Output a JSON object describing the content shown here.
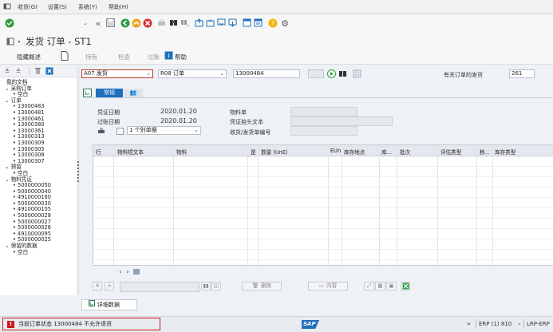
{
  "menubar": {
    "items": [
      "收货(G)",
      "设置(S)",
      "系统(Y)",
      "帮助(H)"
    ]
  },
  "title": {
    "text": "发货 订单 - ST1"
  },
  "appbar": {
    "hide_overview": "隐藏概述",
    "hold": "持有",
    "check": "检查",
    "post": "过账",
    "help": "帮助"
  },
  "header": {
    "action": "A07 发货",
    "ref_doc": "R08 订单",
    "order_number": "13000484",
    "right_label": "有关订单的发货",
    "movement_type": "261"
  },
  "tabs": {
    "general": "常规"
  },
  "general_fields": {
    "doc_date_label": "凭证日期",
    "doc_date": "2020.01.20",
    "post_date_label": "过账日期",
    "post_date": "2020.01.20",
    "slip_option": "1 个别单据",
    "material_slip_label": "物料单",
    "header_text_label": "凭证抬头文本",
    "goods_receipt_label": "收货/发货单编号"
  },
  "navigation": {
    "root": "我的文档",
    "groups": [
      {
        "label": "采购订单",
        "items": [
          "空白"
        ]
      },
      {
        "label": "订单",
        "items": [
          "13000483",
          "13000481",
          "13000461",
          "13000380",
          "13000361",
          "13000313",
          "13000309",
          "13000305",
          "13000308",
          "13000307"
        ]
      },
      {
        "label": "预留",
        "items": [
          "空白"
        ]
      },
      {
        "label": "物料凭证",
        "items": [
          "5000000050",
          "5000000040",
          "4910000160",
          "5000000030",
          "4910000105",
          "5000000028",
          "5000000027",
          "5000000026",
          "4910000095",
          "5000000025"
        ]
      },
      {
        "label": "保留的数据",
        "items": [
          "空白"
        ]
      }
    ]
  },
  "grid": {
    "columns": [
      "行",
      "物料短文本",
      "物料",
      "是",
      "数量 (UnE)",
      "EUn",
      "库存地点",
      "库...",
      "批次",
      "评估类型",
      "移...",
      "库存类型"
    ],
    "rows": []
  },
  "grid_toolbar": {
    "delete": "删除",
    "content": "内容"
  },
  "details": {
    "label": "详细数据"
  },
  "status": {
    "message": "当前订单状态 13000484 不允许退货",
    "system": "ERP (1) 810",
    "server": "LRP-ERP",
    "brand": "SAP"
  },
  "colors": {
    "accent": "#1f6fbf",
    "error": "#cc1b1b",
    "success": "#2e9b3e"
  }
}
